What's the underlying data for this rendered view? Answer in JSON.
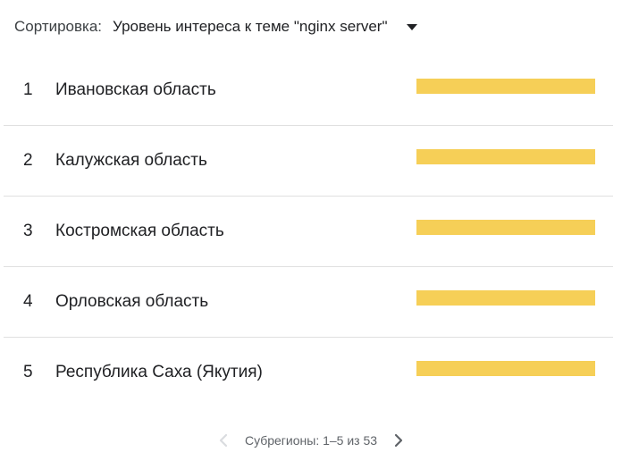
{
  "sort": {
    "label": "Сортировка:",
    "value": "Уровень интереса к теме \"nginx server\""
  },
  "bar_color": "#f6cf57",
  "rows": [
    {
      "rank": "1",
      "name": "Ивановская область",
      "value_percent": 100
    },
    {
      "rank": "2",
      "name": "Калужская область",
      "value_percent": 100
    },
    {
      "rank": "3",
      "name": "Костромская область",
      "value_percent": 100
    },
    {
      "rank": "4",
      "name": "Орловская область",
      "value_percent": 100
    },
    {
      "rank": "5",
      "name": "Республика Саха (Якутия)",
      "value_percent": 100
    }
  ],
  "pagination": {
    "text": "Субрегионы: 1–5 из 53",
    "prev_icon": "chevron-left-icon",
    "next_icon": "chevron-right-icon",
    "prev_enabled": false,
    "next_enabled": true
  }
}
